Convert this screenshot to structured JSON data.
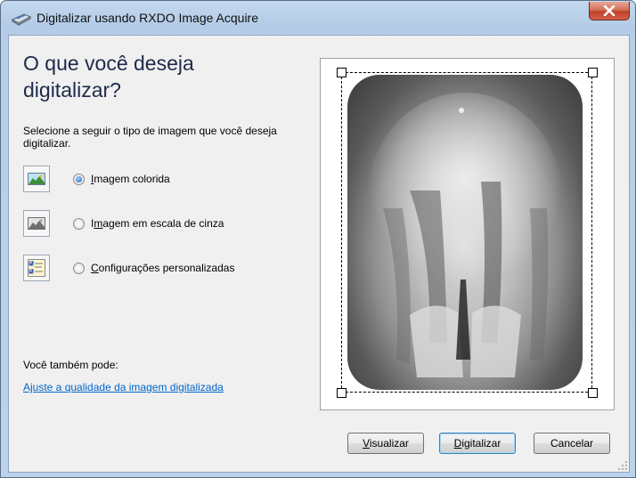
{
  "window": {
    "title": "Digitalizar usando RXDO Image Acquire",
    "icon": "scanner-icon"
  },
  "heading": "O que você deseja digitalizar?",
  "description": "Selecione a seguir o tipo de imagem que você deseja digitalizar.",
  "options": [
    {
      "mn": "I",
      "rest": "magem colorida",
      "checked": true,
      "icon": "color-picture-icon"
    },
    {
      "pre": "I",
      "mn": "m",
      "rest": "agem em escala de cinza",
      "checked": false,
      "icon": "grayscale-picture-icon"
    },
    {
      "mn": "C",
      "rest": "onfigurações personalizadas",
      "checked": false,
      "icon": "custom-settings-icon"
    }
  ],
  "also_label": "Você também pode:",
  "quality_link": "Ajuste a qualidade da imagem digitalizada",
  "buttons": {
    "preview": {
      "mn": "V",
      "rest": "isualizar"
    },
    "scan": {
      "mn": "D",
      "rest": "igitalizar"
    },
    "cancel": "Cancelar"
  },
  "preview_image": "dental-xray-image",
  "colors": {
    "link": "#0066cc",
    "close": "#c0402a",
    "frame": "#b9cfe9"
  }
}
